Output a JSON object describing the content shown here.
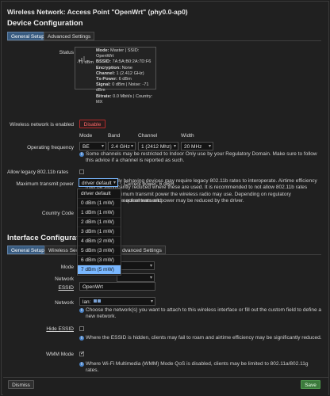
{
  "window_title": "Wireless Network: Access Point \"OpenWrt\" (phy0.0-ap0)",
  "device_config": {
    "heading": "Device Configuration",
    "tabs": [
      "General Setup",
      "Advanced Settings"
    ],
    "status": {
      "label": "Status",
      "signal": "-71 dBm",
      "lines": [
        {
          "k": "Mode:",
          "v": "Master | SSID: OpenWrt"
        },
        {
          "k": "BSSID:",
          "v": "7A:5A:B0:2A:7D:F6"
        },
        {
          "k": "Encryption:",
          "v": "None"
        },
        {
          "k": "Channel:",
          "v": "1 (2.412 GHz)"
        },
        {
          "k": "Tx-Power:",
          "v": "6 dBm"
        },
        {
          "k": "Signal:",
          "v": "0 dBm | Noise: -71 dBm"
        },
        {
          "k": "Bitrate:",
          "v": "0.0 Mbit/s | Country: MX"
        }
      ]
    },
    "wireless_enabled": {
      "label": "Wireless network is enabled",
      "button": "Disable"
    },
    "operating_frequency": {
      "label": "Operating frequency",
      "cols": [
        "Mode",
        "Band",
        "Channel",
        "Width"
      ],
      "values": [
        "BE",
        "2.4 GHz",
        "1 (2412 Mhz)",
        "20 MHz"
      ],
      "help": "Some channels may be restricted to Indoor Only use by your Regulatory Domain. Make sure to follow this advice if a channel is reported as such."
    },
    "legacy": {
      "label": "Allow legacy 802.11b rates",
      "help": "Legacy or badly behaving devices may require legacy 802.11b rates to interoperate. Airtime efficiency may be significantly reduced where these are used. It is recommended to not allow 802.11b rates where possible."
    },
    "tx_power": {
      "label": "Maximum transmit power",
      "selected": "driver default",
      "current": "- Current power: 6 dBm",
      "help_a": "imum transmit power the wireless radio may use. Depending on regulatory requirements and",
      "help_b": "e actual transmit power may be reduced by the driver.",
      "options": [
        "driver default",
        "0 dBm (1 mW)",
        "1 dBm (1 mW)",
        "2 dBm (1 mW)",
        "3 dBm (1 mW)",
        "4 dBm (2 mW)",
        "5 dBm (3 mW)",
        "6 dBm (3 mW)",
        "7 dBm (5 mW)"
      ]
    },
    "country_code": {
      "label": "Country Code"
    }
  },
  "interface_config": {
    "heading": "Interface Configuration",
    "tabs": [
      "General Setup",
      "Wireless Securi",
      "Advanced Settings"
    ],
    "tab3_visible": "dvanced Settings",
    "mode": {
      "label": "Mode"
    },
    "network_select": {
      "label": "Network"
    },
    "essid": {
      "label": "ESSID",
      "value": "OpenWrt"
    },
    "network": {
      "label": "Network",
      "value": "lan:",
      "help": "Choose the network(s) you want to attach to this wireless interface or fill out the custom field to define a new network."
    },
    "hide_essid": {
      "label": "Hide ESSID",
      "help": "Where the ESSID is hidden, clients may fail to roam and airtime efficiency may be significantly reduced."
    },
    "wmm": {
      "label": "WMM Mode",
      "help": "Where Wi-Fi Multimedia (WMM) Mode QoS is disabled, clients may be limited to 802.11a/802.11g rates."
    }
  },
  "footer": {
    "dismiss": "Dismiss",
    "save": "Save"
  },
  "colors": {
    "accent": "#375a7f",
    "danger": "#ff6a6a",
    "save": "#3c7a3c",
    "highlight": "#79b7ff"
  }
}
